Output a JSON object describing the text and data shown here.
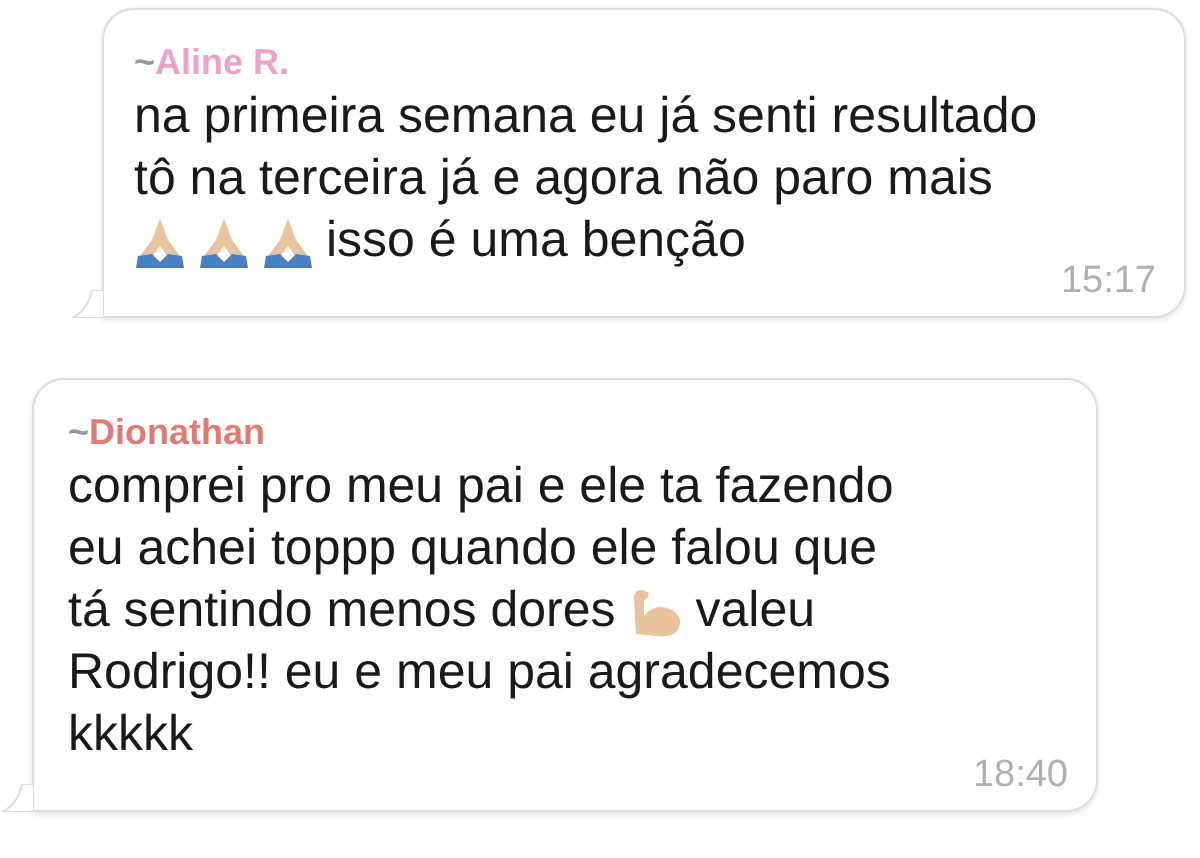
{
  "messages": [
    {
      "prefix": "~",
      "sender": "Aline R.",
      "color": "#eba3c9",
      "lines": [
        [
          {
            "kind": "text",
            "text": "na primeira semana eu já senti resultado"
          }
        ],
        [
          {
            "kind": "text",
            "text": "tô na terceira já e agora não paro mais"
          }
        ],
        [
          {
            "kind": "hands"
          },
          {
            "kind": "hands"
          },
          {
            "kind": "hands"
          },
          {
            "kind": "text",
            "text": "isso é uma benção"
          }
        ]
      ],
      "time": "15:17"
    },
    {
      "prefix": "~",
      "sender": "Dionathan",
      "color": "#e07a72",
      "lines": [
        [
          {
            "kind": "text",
            "text": "comprei pro meu pai e ele ta fazendo"
          }
        ],
        [
          {
            "kind": "text",
            "text": "eu achei toppp quando ele falou que"
          }
        ],
        [
          {
            "kind": "text",
            "text": "tá sentindo menos dores"
          },
          {
            "kind": "arm"
          },
          {
            "kind": "text",
            "text": "valeu"
          }
        ],
        [
          {
            "kind": "text",
            "text": "Rodrigo!! eu e meu pai agradecemos"
          }
        ],
        [
          {
            "kind": "text",
            "text": "kkkkk"
          }
        ]
      ],
      "time": "18:40"
    }
  ]
}
